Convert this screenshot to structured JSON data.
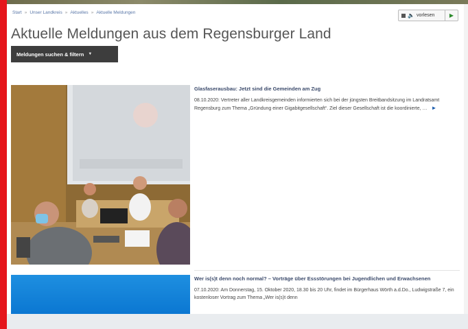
{
  "breadcrumb": [
    "Start",
    "Unser Landkreis",
    "Aktuelles",
    "Aktuelle Meldungen"
  ],
  "readspeaker": {
    "label": "vorlesen"
  },
  "page": {
    "title": "Aktuelle Meldungen aus dem Regensburger Land"
  },
  "filter": {
    "label": "Meldungen suchen & filtern"
  },
  "news": [
    {
      "title": "Glasfaserausbau: Jetzt sind die Gemeinden am Zug",
      "teaser": "08.10.2020: Vertreter aller Landkreisgemeinden informierten sich bei der jüngsten Breitbandsitzung im Landratsamt Regensburg zum Thema „Gründung einer Gigabitgesellschaft“. Ziel dieser Gesellschaft ist die koordinierte, …"
    },
    {
      "title": "Wer is(s)t denn noch normal? – Vorträge über Essstörungen bei Jugendlichen und Erwachsenen",
      "teaser": "07.10.2020: Am Donnerstag, 15. Oktober 2020, 18.30 bis 20 Uhr, findet im Bürgerhaus Wörth a.d.Do., Ludwigstraße 7, ein kostenloser Vortrag zum Thema „Wer is(s)t denn"
    }
  ],
  "colors": {
    "accent_red": "#e5161b",
    "link_blue": "#1f5fae",
    "button_dark": "#3d3d3d"
  }
}
